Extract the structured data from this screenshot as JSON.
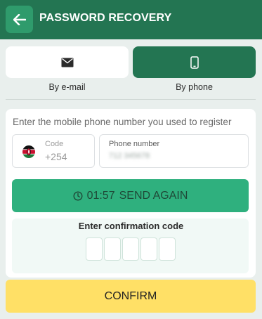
{
  "header": {
    "title": "PASSWORD RECOVERY",
    "back_icon": "arrow-left-icon"
  },
  "tabs": [
    {
      "label": "By e-mail",
      "icon": "envelope-icon",
      "active": false
    },
    {
      "label": "By phone",
      "icon": "smartphone-icon",
      "active": true
    }
  ],
  "form": {
    "instruction": "Enter the mobile phone number you used to register",
    "code": {
      "label": "Code",
      "value": "+254",
      "flag": "kenya-flag-icon"
    },
    "phone": {
      "label": "Phone number",
      "value": "712 345678"
    },
    "send_again": {
      "timer": "01:57",
      "label": "SEND AGAIN",
      "icon": "clock-icon"
    },
    "confirmation": {
      "title": "Enter confirmation code",
      "digits": 5
    }
  },
  "confirm_button": {
    "label": "CONFIRM"
  },
  "colors": {
    "header_bg": "#237552",
    "accent_green": "#2fb07e",
    "confirm_yellow": "#ffe066"
  }
}
